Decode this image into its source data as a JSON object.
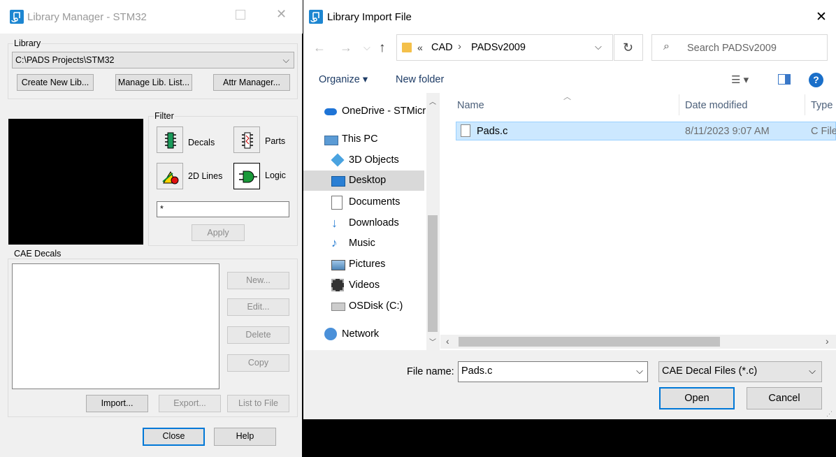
{
  "library_manager": {
    "title": "Library Manager - STM32",
    "library_group_label": "Library",
    "library_path": "C:\\PADS Projects\\STM32",
    "buttons": {
      "create_new_lib": "Create New Lib...",
      "manage_lib_list": "Manage Lib. List...",
      "attr_manager": "Attr Manager..."
    },
    "filter": {
      "label": "Filter",
      "items": [
        "Decals",
        "Parts",
        "2D Lines",
        "Logic"
      ],
      "filter_text": "*",
      "apply": "Apply"
    },
    "cae_decals": {
      "label": "CAE Decals",
      "new": "New...",
      "edit": "Edit...",
      "delete": "Delete",
      "copy": "Copy",
      "import": "Import...",
      "export": "Export...",
      "list_to_file": "List to File"
    },
    "close": "Close",
    "help": "Help"
  },
  "import_dialog": {
    "title": "Library Import File",
    "breadcrumb": [
      "CAD",
      "PADSv2009"
    ],
    "breadcrumb_prefix": "«",
    "search_placeholder": "Search PADSv2009",
    "toolbar": {
      "organize": "Organize",
      "new_folder": "New folder"
    },
    "nav": [
      {
        "label": "OneDrive - STMicr",
        "icon": "onedrive-icon"
      },
      {
        "label": "This PC",
        "icon": "pc-icon"
      },
      {
        "label": "3D Objects",
        "icon": "3d-objects-icon"
      },
      {
        "label": "Desktop",
        "icon": "desktop-icon"
      },
      {
        "label": "Documents",
        "icon": "documents-icon"
      },
      {
        "label": "Downloads",
        "icon": "downloads-icon"
      },
      {
        "label": "Music",
        "icon": "music-icon"
      },
      {
        "label": "Pictures",
        "icon": "pictures-icon"
      },
      {
        "label": "Videos",
        "icon": "videos-icon"
      },
      {
        "label": "OSDisk (C:)",
        "icon": "disk-icon"
      },
      {
        "label": "Network",
        "icon": "network-icon"
      }
    ],
    "columns": [
      "Name",
      "Date modified",
      "Type"
    ],
    "files": [
      {
        "name": "Pads.c",
        "date": "8/11/2023 9:07 AM",
        "type": "C File"
      }
    ],
    "file_name_label": "File name:",
    "file_name_value": "Pads.c",
    "file_type": "CAE Decal Files (*.c)",
    "open": "Open",
    "cancel": "Cancel"
  },
  "colors": {
    "accent": "#0078d7",
    "selection": "#cce8ff",
    "nav_selected": "#d9d9d9"
  }
}
